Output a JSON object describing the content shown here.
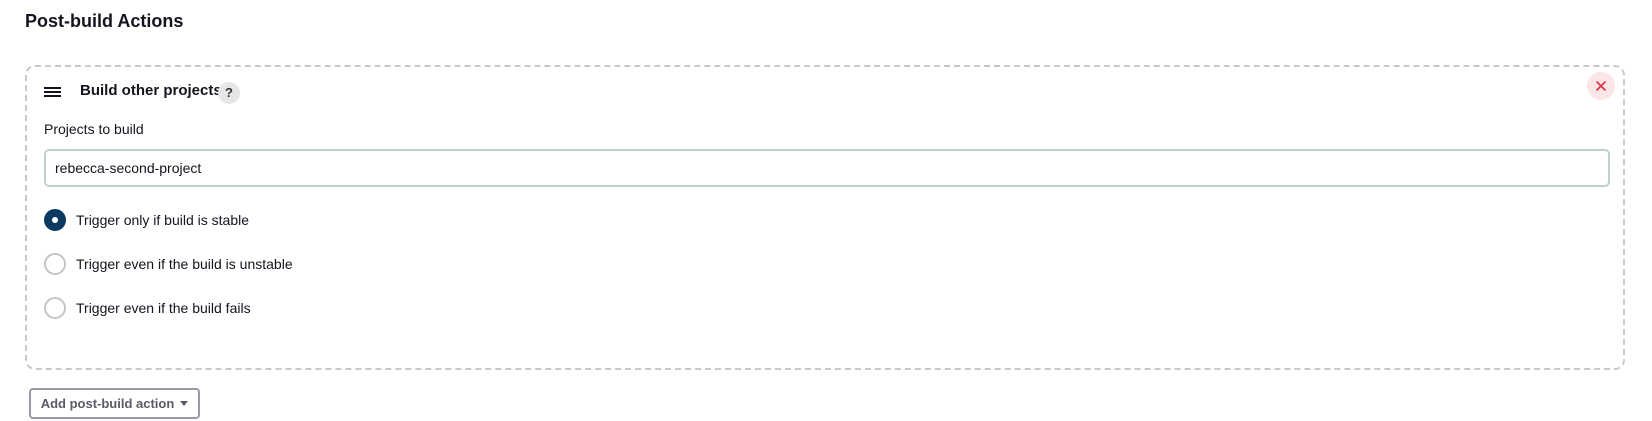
{
  "section": {
    "title": "Post-build Actions"
  },
  "card": {
    "title": "Build other projects",
    "help_label": "?",
    "drag_icon": "hamburger-menu-icon",
    "close_icon": "close-x-icon",
    "close_color": "#e0303f",
    "projects_field": {
      "label": "Projects to build",
      "value": "rebecca-second-project"
    },
    "trigger_options": [
      {
        "label": "Trigger only if build is stable",
        "checked": true
      },
      {
        "label": "Trigger even if the build is unstable",
        "checked": false
      },
      {
        "label": "Trigger even if the build fails",
        "checked": false
      }
    ],
    "radio_checked_color": "#0b3a61"
  },
  "add_action_button": {
    "label": "Add post-build action",
    "icon": "caret-down-icon"
  }
}
